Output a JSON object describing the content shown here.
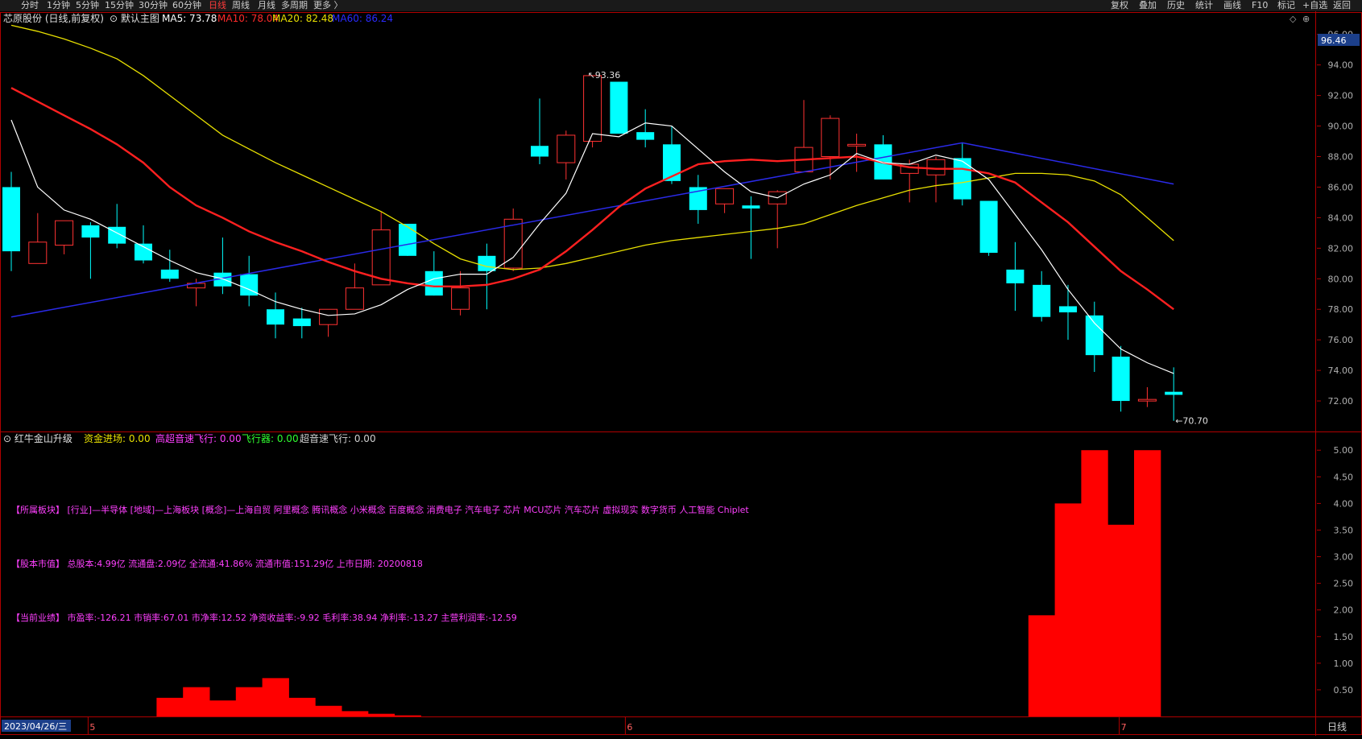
{
  "toolbar": {
    "periods": [
      "分时",
      "1分钟",
      "5分钟",
      "15分钟",
      "30分钟",
      "60分钟",
      "日线",
      "周线",
      "月线",
      "多周期",
      "更多 〉"
    ],
    "active_period": "日线",
    "right_buttons": [
      "复权",
      "叠加",
      "历史",
      "统计",
      "画线",
      "F10",
      "标记",
      "+自选",
      "返回"
    ]
  },
  "main_panel": {
    "stock_title": "芯原股份 (日线,前复权)",
    "template_label": "默认主图",
    "ma_labels": [
      {
        "text": "MA5: 73.78",
        "color": "#ffffff"
      },
      {
        "text": "MA10: 78.04",
        "color": "#ff2a2a"
      },
      {
        "text": "MA20: 82.48",
        "color": "#e8e000"
      },
      {
        "text": "MA60: 86.24",
        "color": "#2a2aff"
      }
    ],
    "high_marker": "93.36",
    "low_marker": "70.70",
    "price_box": "96.46"
  },
  "indicator_panel": {
    "name": "红牛金山升级",
    "values": [
      {
        "text": "资金进场: 0.00",
        "color": "#e8e000"
      },
      {
        "text": "高超音速飞行: 0.00",
        "color": "#ff40ff"
      },
      {
        "text": "飞行器: 0.00",
        "color": "#30ff30"
      },
      {
        "text": "超音速飞行: 0.00",
        "color": "#d0d0d0"
      }
    ],
    "info_lines": [
      "【所属板块】 [行业]—半导体 [地域]—上海板块 [概念]—上海自贸 阿里概念 腾讯概念 小米概念 百度概念 消费电子 汽车电子 芯片 MCU芯片 汽车芯片 虚拟现实 数字货币 人工智能 Chiplet",
      "【股本市值】 总股本:4.99亿 流通盘:2.09亿 全流通:41.86% 流通市值:151.29亿 上市日期: 20200818",
      "【当前业绩】 市盈率:-126.21 市销率:67.01 市净率:12.52 净资收益率:-9.92 毛利率:38.94 净利率:-13.27 主营利润率:-12.59"
    ]
  },
  "bottom_bar": {
    "date_label": "2023/04/26/三",
    "month_labels": [
      "5",
      "6",
      "7"
    ],
    "period_label": "日线"
  },
  "colors": {
    "up": "#ff3232",
    "down": "#00ffff",
    "ma5": "#ffffff",
    "ma10": "#ff2020",
    "ma20": "#e8e000",
    "ma60": "#2a2ae8",
    "border": "#b00000",
    "grid": "#b00000",
    "axis_text": "#b0b0b0",
    "info_text": "#ff40ff",
    "hist": "#ff0000"
  },
  "chart_data": [
    {
      "type": "candlestick",
      "title": "芯原股份 (日线,前复权)",
      "ylim": [
        70,
        96.46
      ],
      "yticks": [
        72,
        74,
        76,
        78,
        80,
        82,
        84,
        86,
        88,
        90,
        92,
        94,
        96
      ],
      "candles": [
        {
          "o": 86.0,
          "h": 87.0,
          "l": 80.5,
          "c": 81.8
        },
        {
          "o": 81.0,
          "h": 84.3,
          "l": 81.0,
          "c": 82.4
        },
        {
          "o": 82.2,
          "h": 83.8,
          "l": 81.6,
          "c": 83.8
        },
        {
          "o": 83.5,
          "h": 83.7,
          "l": 80.0,
          "c": 82.7
        },
        {
          "o": 83.4,
          "h": 84.9,
          "l": 82.0,
          "c": 82.3
        },
        {
          "o": 82.3,
          "h": 83.5,
          "l": 81.0,
          "c": 81.2
        },
        {
          "o": 80.6,
          "h": 81.9,
          "l": 79.8,
          "c": 80.0
        },
        {
          "o": 79.4,
          "h": 80.0,
          "l": 78.2,
          "c": 79.7
        },
        {
          "o": 80.4,
          "h": 82.7,
          "l": 79.0,
          "c": 79.5
        },
        {
          "o": 80.3,
          "h": 81.5,
          "l": 78.2,
          "c": 78.9
        },
        {
          "o": 78.0,
          "h": 79.1,
          "l": 76.1,
          "c": 77.0
        },
        {
          "o": 77.4,
          "h": 78.1,
          "l": 76.1,
          "c": 76.9
        },
        {
          "o": 77.0,
          "h": 78.0,
          "l": 76.2,
          "c": 78.0
        },
        {
          "o": 78.0,
          "h": 81.0,
          "l": 78.0,
          "c": 79.4
        },
        {
          "o": 79.6,
          "h": 84.4,
          "l": 79.6,
          "c": 83.2
        },
        {
          "o": 83.6,
          "h": 83.6,
          "l": 81.5,
          "c": 81.5
        },
        {
          "o": 80.5,
          "h": 81.8,
          "l": 78.9,
          "c": 78.9
        },
        {
          "o": 78.0,
          "h": 80.5,
          "l": 77.6,
          "c": 79.4
        },
        {
          "o": 81.5,
          "h": 82.3,
          "l": 78.0,
          "c": 80.5
        },
        {
          "o": 80.7,
          "h": 84.6,
          "l": 80.5,
          "c": 83.9
        },
        {
          "o": 88.7,
          "h": 91.8,
          "l": 87.5,
          "c": 88.0
        },
        {
          "o": 87.6,
          "h": 89.7,
          "l": 86.5,
          "c": 89.4
        },
        {
          "o": 89.0,
          "h": 93.3,
          "l": 88.6,
          "c": 93.3
        },
        {
          "o": 92.9,
          "h": 92.9,
          "l": 89.5,
          "c": 89.5
        },
        {
          "o": 89.6,
          "h": 91.1,
          "l": 88.6,
          "c": 89.1
        },
        {
          "o": 88.8,
          "h": 90.0,
          "l": 86.2,
          "c": 86.4
        },
        {
          "o": 86.0,
          "h": 86.8,
          "l": 83.6,
          "c": 84.5
        },
        {
          "o": 84.9,
          "h": 85.9,
          "l": 84.3,
          "c": 85.9
        },
        {
          "o": 84.8,
          "h": 85.4,
          "l": 81.3,
          "c": 84.6
        },
        {
          "o": 84.9,
          "h": 85.8,
          "l": 82.0,
          "c": 85.7
        },
        {
          "o": 87.0,
          "h": 91.7,
          "l": 87.0,
          "c": 88.6
        },
        {
          "o": 88.0,
          "h": 90.7,
          "l": 86.5,
          "c": 90.5
        },
        {
          "o": 88.8,
          "h": 89.5,
          "l": 87.0,
          "c": 88.8
        },
        {
          "o": 88.8,
          "h": 89.4,
          "l": 86.5,
          "c": 86.5
        },
        {
          "o": 86.9,
          "h": 87.8,
          "l": 85.0,
          "c": 87.5
        },
        {
          "o": 86.8,
          "h": 88.0,
          "l": 85.0,
          "c": 87.8
        },
        {
          "o": 87.9,
          "h": 88.9,
          "l": 84.8,
          "c": 85.2
        },
        {
          "o": 85.1,
          "h": 85.1,
          "l": 81.5,
          "c": 81.7
        },
        {
          "o": 80.6,
          "h": 82.4,
          "l": 77.9,
          "c": 79.7
        },
        {
          "o": 79.6,
          "h": 80.5,
          "l": 77.2,
          "c": 77.5
        },
        {
          "o": 78.2,
          "h": 79.6,
          "l": 76.0,
          "c": 77.8
        },
        {
          "o": 77.6,
          "h": 78.5,
          "l": 73.9,
          "c": 75.0
        },
        {
          "o": 74.9,
          "h": 75.6,
          "l": 71.3,
          "c": 72.0
        },
        {
          "o": 72.1,
          "h": 72.9,
          "l": 71.6,
          "c": 72.1
        },
        {
          "o": 72.6,
          "h": 74.2,
          "l": 70.7,
          "c": 72.4
        }
      ],
      "ma5": [
        90.4,
        86.0,
        84.5,
        83.9,
        83.0,
        82.1,
        81.2,
        80.4,
        80.0,
        79.3,
        78.5,
        78.0,
        77.6,
        77.7,
        78.3,
        79.3,
        80.0,
        80.3,
        80.3,
        81.4,
        83.6,
        85.6,
        89.5,
        89.3,
        90.2,
        90.0,
        88.5,
        87.0,
        85.7,
        85.3,
        86.2,
        86.8,
        88.2,
        87.6,
        87.5,
        88.1,
        87.7,
        86.5,
        84.2,
        81.9,
        79.3,
        77.1,
        75.4,
        74.5,
        73.8
      ],
      "ma10": [
        92.5,
        91.6,
        90.7,
        89.8,
        88.8,
        87.6,
        86.0,
        84.8,
        84.0,
        83.1,
        82.4,
        81.8,
        81.1,
        80.5,
        80.0,
        79.7,
        79.5,
        79.5,
        79.6,
        80.0,
        80.6,
        81.8,
        83.2,
        84.7,
        85.9,
        86.7,
        87.5,
        87.7,
        87.8,
        87.7,
        87.8,
        87.9,
        88.0,
        87.6,
        87.3,
        87.2,
        87.2,
        86.9,
        86.3,
        85.0,
        83.7,
        82.1,
        80.5,
        79.3,
        78.0
      ],
      "ma20": [
        96.6,
        96.2,
        95.7,
        95.1,
        94.4,
        93.3,
        92.0,
        90.7,
        89.4,
        88.5,
        87.6,
        86.8,
        86.0,
        85.2,
        84.4,
        83.4,
        82.3,
        81.3,
        80.8,
        80.6,
        80.7,
        81.0,
        81.4,
        81.8,
        82.2,
        82.5,
        82.7,
        82.9,
        83.1,
        83.3,
        83.6,
        84.2,
        84.8,
        85.3,
        85.8,
        86.1,
        86.3,
        86.6,
        86.9,
        86.9,
        86.8,
        86.4,
        85.5,
        84.0,
        82.5
      ],
      "ma60": [
        77.5,
        null,
        null,
        null,
        null,
        null,
        null,
        null,
        null,
        null,
        null,
        null,
        null,
        null,
        null,
        null,
        null,
        null,
        null,
        null,
        null,
        null,
        null,
        null,
        null,
        null,
        null,
        null,
        null,
        null,
        null,
        null,
        null,
        null,
        null,
        null,
        88.9,
        null,
        null,
        null,
        null,
        null,
        null,
        null,
        86.2
      ]
    },
    {
      "type": "bar",
      "title": "红牛金山升级",
      "ylim": [
        0,
        5.2
      ],
      "yticks": [
        0.5,
        1.0,
        1.5,
        2.0,
        2.5,
        3.0,
        3.5,
        4.0,
        4.5,
        5.0
      ],
      "values": [
        0,
        0,
        0,
        0,
        0,
        0.0,
        0.35,
        0.55,
        0.3,
        0.55,
        0.72,
        0.35,
        0.2,
        0.1,
        0.05,
        0.02,
        0,
        0,
        0,
        0,
        0,
        0,
        0,
        0,
        0,
        0,
        0,
        0,
        0,
        0,
        0,
        0,
        0,
        0,
        0,
        0,
        0,
        0,
        0,
        1.9,
        4.0,
        5.0,
        3.6,
        5.0,
        0
      ]
    }
  ]
}
